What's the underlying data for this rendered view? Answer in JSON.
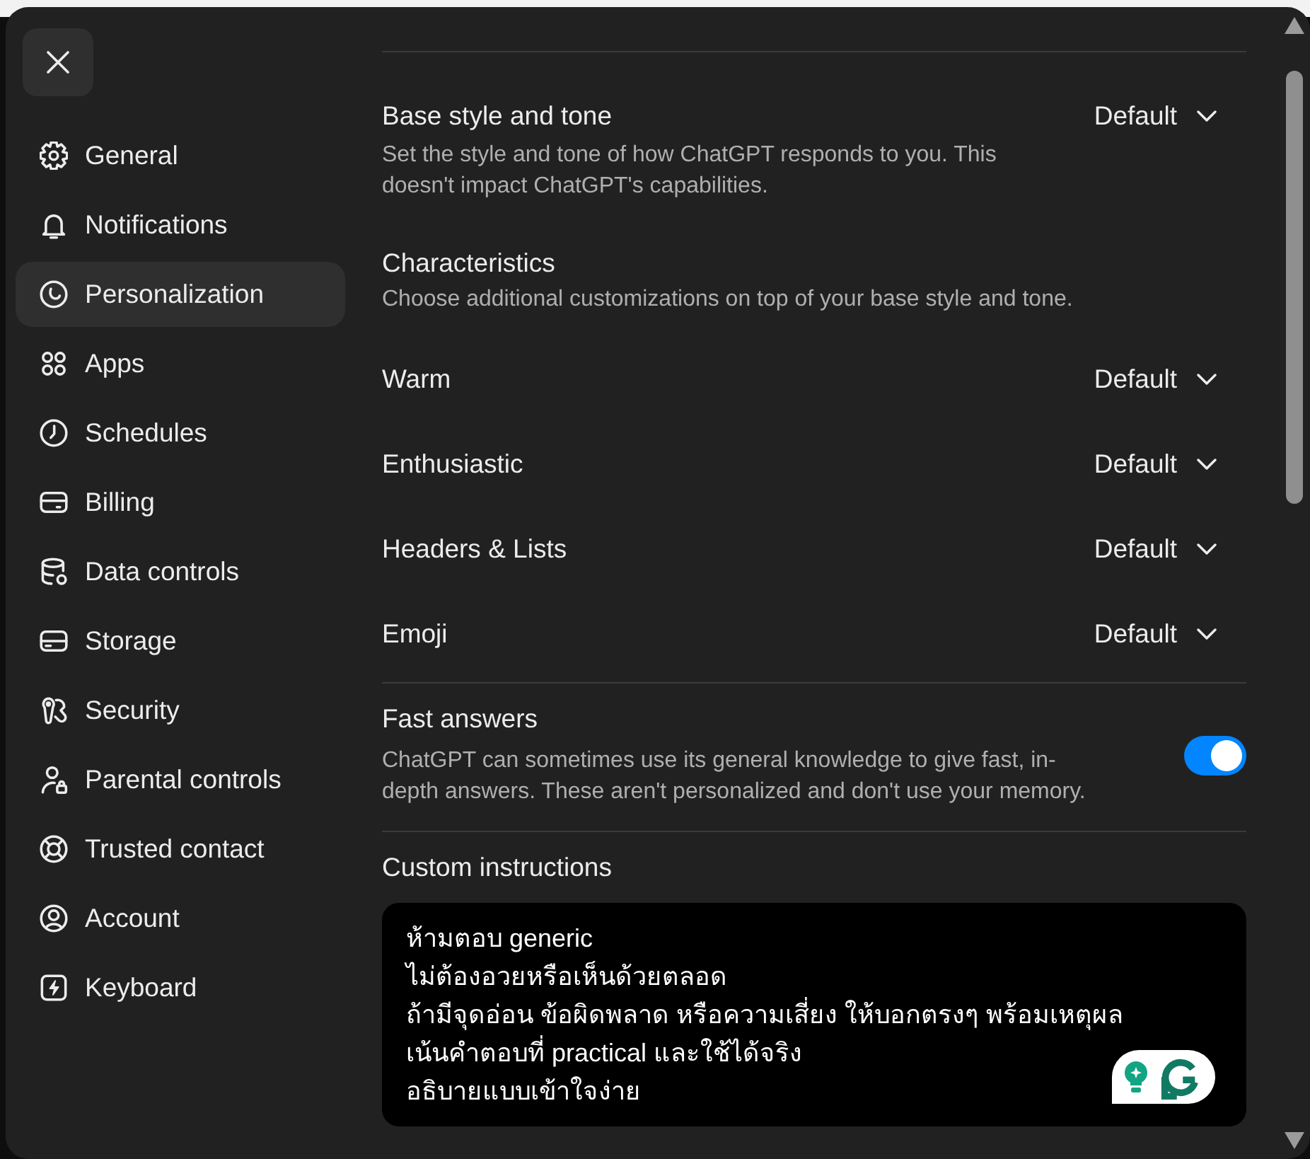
{
  "sidebar": {
    "items": [
      {
        "label": "General",
        "selected": false
      },
      {
        "label": "Notifications",
        "selected": false
      },
      {
        "label": "Personalization",
        "selected": true
      },
      {
        "label": "Apps",
        "selected": false
      },
      {
        "label": "Schedules",
        "selected": false
      },
      {
        "label": "Billing",
        "selected": false
      },
      {
        "label": "Data controls",
        "selected": false
      },
      {
        "label": "Storage",
        "selected": false
      },
      {
        "label": "Security",
        "selected": false
      },
      {
        "label": "Parental controls",
        "selected": false
      },
      {
        "label": "Trusted contact",
        "selected": false
      },
      {
        "label": "Account",
        "selected": false
      },
      {
        "label": "Keyboard",
        "selected": false
      }
    ]
  },
  "settings": [
    {
      "kind": "select",
      "title": "Base style and tone",
      "description": "Set the style and tone of how ChatGPT responds to you. This doesn't impact ChatGPT's capabilities.",
      "value": "Default"
    },
    {
      "kind": "heading",
      "title": "Characteristics",
      "description": "Choose additional customizations on top of your base style and tone."
    },
    {
      "kind": "select",
      "title": "Warm",
      "value": "Default"
    },
    {
      "kind": "select",
      "title": "Enthusiastic",
      "value": "Default"
    },
    {
      "kind": "select",
      "title": "Headers & Lists",
      "value": "Default"
    },
    {
      "kind": "select",
      "title": "Emoji",
      "value": "Default"
    },
    {
      "kind": "toggle",
      "title": "Fast answers",
      "description": "ChatGPT can sometimes use its general knowledge to give fast, in-depth answers. These aren't personalized and don't use your memory.",
      "on": true
    },
    {
      "kind": "textarea",
      "title": "Custom instructions",
      "value": "ห้ามตอบ generic\nไม่ต้องอวยหรือเห็นด้วยตลอด\nถ้ามีจุดอ่อน ข้อผิดพลาด หรือความเสี่ยง ให้บอกตรงๆ พร้อมเหตุผล\nเน้นคำตอบที่ practical และใช้ได้จริง\nอธิบายแบบเข้าใจง่าย"
    }
  ]
}
